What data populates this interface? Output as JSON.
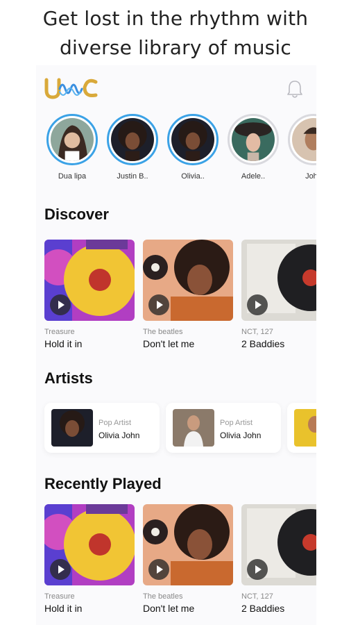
{
  "headline": {
    "line1": "Get lost in the rhythm with",
    "line2": "diverse library of music"
  },
  "app": {
    "logo_text": "UWC",
    "icons": {
      "notification": "bell-icon",
      "play": "play-icon"
    },
    "colors": {
      "accent": "#3ba2e6",
      "logo_gold": "#d9a93a",
      "logo_blue": "#3a8fe0"
    }
  },
  "stories": [
    {
      "name": "Dua lipa",
      "active": true
    },
    {
      "name": "Justin B..",
      "active": true
    },
    {
      "name": "Olivia..",
      "active": true
    },
    {
      "name": "Adele..",
      "active": false
    },
    {
      "name": "John",
      "active": false
    }
  ],
  "discover": {
    "title": "Discover",
    "items": [
      {
        "artist": "Treasure",
        "title": "Hold it in"
      },
      {
        "artist": "The beatles",
        "title": "Don't let me"
      },
      {
        "artist": "NCT, 127",
        "title": "2 Baddies"
      }
    ]
  },
  "artists": {
    "title": "Artists",
    "items": [
      {
        "role": "Pop Artist",
        "name": "Olivia John"
      },
      {
        "role": "Pop Artist",
        "name": "Olivia John"
      }
    ]
  },
  "recently_played": {
    "title": "Recently Played",
    "items": [
      {
        "artist": "Treasure",
        "title": "Hold it in"
      },
      {
        "artist": "The beatles",
        "title": "Don't let me"
      },
      {
        "artist": "NCT, 127",
        "title": "2 Baddies"
      }
    ]
  }
}
